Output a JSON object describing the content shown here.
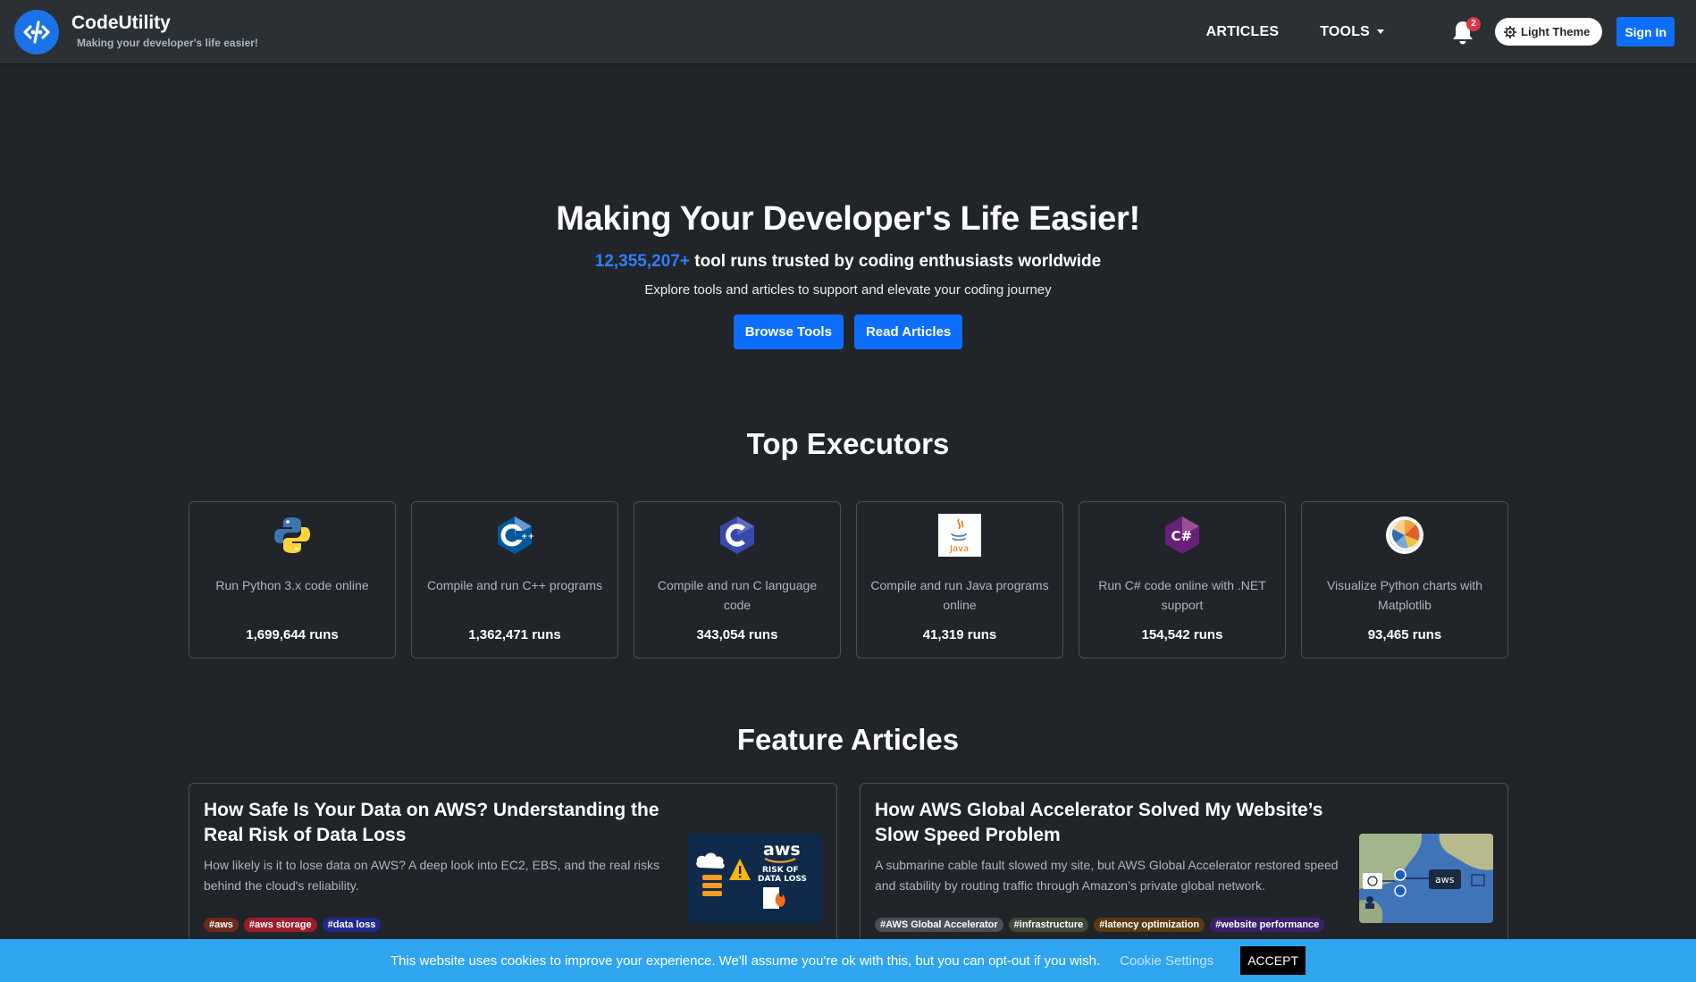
{
  "nav": {
    "brand_name": "CodeUtility",
    "brand_tagline": "Making your developer's life easier!",
    "links": [
      {
        "label": "ARTICLES"
      },
      {
        "label": "TOOLS"
      }
    ],
    "notification_count": "2",
    "theme_toggle_label": "Light Theme",
    "signin_label": "Sign In"
  },
  "hero": {
    "title": "Making Your Developer's Life Easier!",
    "runs_count": "12,355,207+",
    "runs_text": " tool runs trusted by coding enthusiasts worldwide",
    "description": "Explore tools and articles to support and elevate your coding journey",
    "browse_label": "Browse Tools",
    "read_label": "Read Articles"
  },
  "executors": {
    "title": "Top Executors",
    "items": [
      {
        "icon": "python-icon",
        "description": "Run Python 3.x code online",
        "runs": "1,699,644 runs"
      },
      {
        "icon": "cpp-icon",
        "description": "Compile and run C++ programs",
        "runs": "1,362,471 runs"
      },
      {
        "icon": "c-icon",
        "description": "Compile and run C language code",
        "runs": "343,054 runs"
      },
      {
        "icon": "java-icon",
        "description": "Compile and run Java programs online",
        "runs": "41,319 runs"
      },
      {
        "icon": "csharp-icon",
        "description": "Run C# code online with .NET support",
        "runs": "154,542 runs"
      },
      {
        "icon": "matplotlib-icon",
        "description": "Visualize Python charts with Matplotlib",
        "runs": "93,465 runs"
      }
    ]
  },
  "articles": {
    "title": "Feature Articles",
    "items": [
      {
        "title": "How Safe Is Your Data on AWS? Understanding the Real Risk of Data Loss",
        "description": "How likely is it to lose data on AWS? A deep look into EC2, EBS, and the real risks behind the cloud's reliability.",
        "image_text": [
          "aws",
          "RISK OF",
          "DATA LOSS"
        ],
        "tags": [
          {
            "label": "#aws",
            "color": "#6b2a1a"
          },
          {
            "label": "#aws storage",
            "color": "#9b1c2c"
          },
          {
            "label": "#data loss",
            "color": "#1f2a8a"
          }
        ]
      },
      {
        "title": "How AWS Global Accelerator Solved My Website’s Slow Speed Problem",
        "description": "A submarine cable fault slowed my site, but AWS Global Accelerator restored speed and stability by routing traffic through Amazon’s private global network.",
        "image_text": [
          "aws"
        ],
        "tags": [
          {
            "label": "#AWS Global Accelerator",
            "color": "#495057"
          },
          {
            "label": "#infrastructure",
            "color": "#3d4a3a"
          },
          {
            "label": "#latency optimization",
            "color": "#5a3a12"
          },
          {
            "label": "#website performance",
            "color": "#3a1f6b"
          }
        ]
      }
    ]
  },
  "cookie": {
    "text": "This website uses cookies to improve your experience. We'll assume you're ok with this, but you can opt-out if you wish.",
    "settings_label": "Cookie Settings",
    "accept_label": "ACCEPT"
  },
  "colors": {
    "background": "#212429",
    "navbar": "#2b3035",
    "accent": "#0d6efd",
    "count_highlight": "#2f7fff",
    "cookie_bar": "#2fa5f0"
  }
}
